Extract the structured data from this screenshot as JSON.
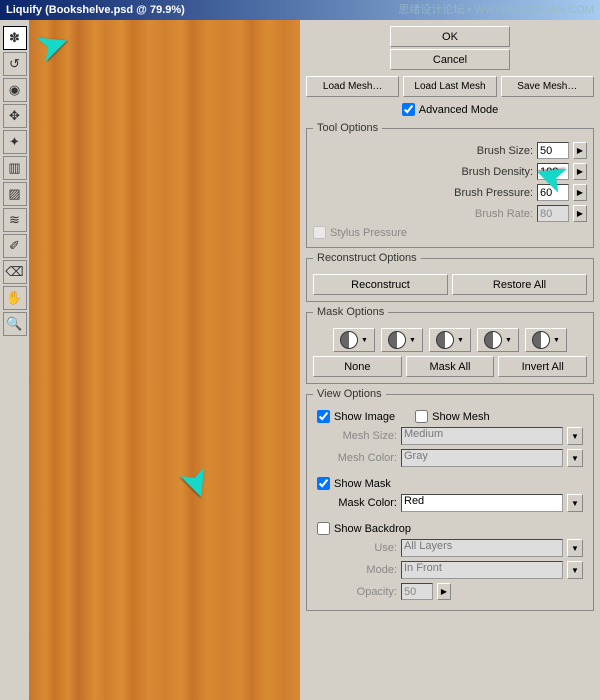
{
  "title": "Liquify (Bookshelve.psd @ 79.9%)",
  "watermark": "思绪设计论坛 • WWW.MISSYUAN.COM",
  "tools": [
    {
      "name": "forward-warp-icon",
      "glyph": "✽",
      "selected": true
    },
    {
      "name": "reconstruct-icon",
      "glyph": "↺",
      "selected": false
    },
    {
      "name": "twirl-icon",
      "glyph": "◉",
      "selected": false
    },
    {
      "name": "pucker-icon",
      "glyph": "✥",
      "selected": false
    },
    {
      "name": "bloat-icon",
      "glyph": "✦",
      "selected": false
    },
    {
      "name": "push-left-icon",
      "glyph": "▥",
      "selected": false
    },
    {
      "name": "mirror-icon",
      "glyph": "▨",
      "selected": false
    },
    {
      "name": "turbulence-icon",
      "glyph": "≋",
      "selected": false
    },
    {
      "name": "freeze-mask-icon",
      "glyph": "✐",
      "selected": false
    },
    {
      "name": "thaw-mask-icon",
      "glyph": "⌫",
      "selected": false
    },
    {
      "name": "hand-icon",
      "glyph": "✋",
      "selected": false
    },
    {
      "name": "zoom-icon",
      "glyph": "🔍",
      "selected": false
    }
  ],
  "buttons": {
    "ok": "OK",
    "cancel": "Cancel",
    "load_mesh": "Load Mesh…",
    "load_last": "Load Last Mesh",
    "save_mesh": "Save Mesh…",
    "reconstruct": "Reconstruct",
    "restore_all": "Restore All",
    "none": "None",
    "mask_all": "Mask All",
    "invert_all": "Invert All"
  },
  "labels": {
    "advanced": "Advanced Mode",
    "tool_options": "Tool Options",
    "brush_size": "Brush Size:",
    "brush_density": "Brush Density:",
    "brush_pressure": "Brush Pressure:",
    "brush_rate": "Brush Rate:",
    "stylus": "Stylus Pressure",
    "reconstruct_options": "Reconstruct Options",
    "mask_options": "Mask Options",
    "view_options": "View Options",
    "show_image": "Show Image",
    "show_mesh": "Show Mesh",
    "mesh_size": "Mesh Size:",
    "mesh_color": "Mesh Color:",
    "show_mask": "Show Mask",
    "mask_color": "Mask Color:",
    "show_backdrop": "Show Backdrop",
    "use": "Use:",
    "mode": "Mode:",
    "opacity": "Opacity:"
  },
  "values": {
    "brush_size": "50",
    "brush_density": "100",
    "brush_pressure": "60",
    "brush_rate": "80",
    "mesh_size": "Medium",
    "mesh_color": "Gray",
    "mask_color": "Red",
    "use": "All Layers",
    "mode": "In Front",
    "opacity": "50"
  },
  "checks": {
    "advanced": true,
    "stylus": false,
    "show_image": true,
    "show_mesh": false,
    "show_mask": true,
    "show_backdrop": false
  }
}
